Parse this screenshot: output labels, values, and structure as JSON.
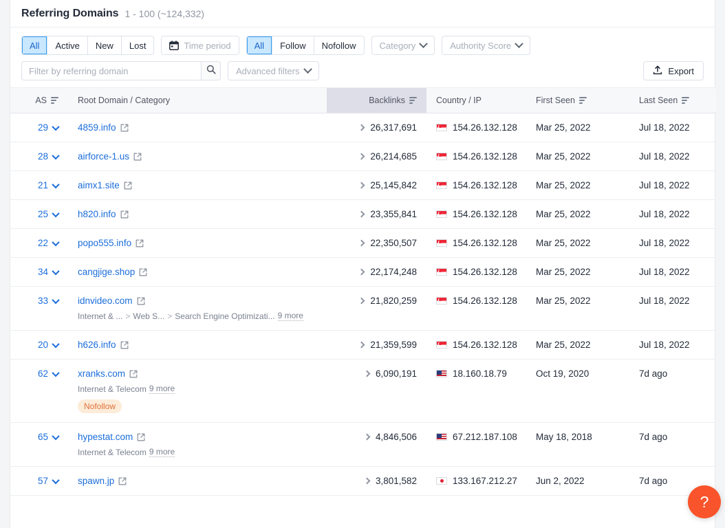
{
  "header": {
    "title": "Referring Domains",
    "range": "1 - 100 (~124,332)"
  },
  "filters": {
    "status_group": [
      "All",
      "Active",
      "New",
      "Lost"
    ],
    "status_active": "All",
    "time_period_label": "Time period",
    "follow_group": [
      "All",
      "Follow",
      "Nofollow"
    ],
    "follow_active": "All",
    "category_label": "Category",
    "authority_label": "Authority Score",
    "search_placeholder": "Filter by referring domain",
    "search_value": "",
    "advanced_filters_label": "Advanced filters",
    "export_label": "Export"
  },
  "table": {
    "columns": [
      {
        "key": "as",
        "label": "AS",
        "sortable": true,
        "highlight": false
      },
      {
        "key": "domain",
        "label": "Root Domain / Category",
        "sortable": false,
        "highlight": false
      },
      {
        "key": "backlinks",
        "label": "Backlinks",
        "sortable": true,
        "highlight": true
      },
      {
        "key": "country",
        "label": "Country / IP",
        "sortable": false,
        "highlight": false
      },
      {
        "key": "first_seen",
        "label": "First Seen",
        "sortable": true,
        "highlight": false
      },
      {
        "key": "last_seen",
        "label": "Last Seen",
        "sortable": true,
        "highlight": false
      }
    ],
    "rows": [
      {
        "as": "29",
        "domain": "4859.info",
        "categories": [],
        "more": null,
        "badge": null,
        "backlinks": "26,317,691",
        "flag": "sg",
        "ip": "154.26.132.128",
        "first_seen": "Mar 25, 2022",
        "last_seen": "Jul 18, 2022"
      },
      {
        "as": "28",
        "domain": "airforce-1.us",
        "categories": [],
        "more": null,
        "badge": null,
        "backlinks": "26,214,685",
        "flag": "sg",
        "ip": "154.26.132.128",
        "first_seen": "Mar 25, 2022",
        "last_seen": "Jul 18, 2022"
      },
      {
        "as": "21",
        "domain": "aimx1.site",
        "categories": [],
        "more": null,
        "badge": null,
        "backlinks": "25,145,842",
        "flag": "sg",
        "ip": "154.26.132.128",
        "first_seen": "Mar 25, 2022",
        "last_seen": "Jul 18, 2022"
      },
      {
        "as": "25",
        "domain": "h820.info",
        "categories": [],
        "more": null,
        "badge": null,
        "backlinks": "23,355,841",
        "flag": "sg",
        "ip": "154.26.132.128",
        "first_seen": "Mar 25, 2022",
        "last_seen": "Jul 18, 2022"
      },
      {
        "as": "22",
        "domain": "popo555.info",
        "categories": [],
        "more": null,
        "badge": null,
        "backlinks": "22,350,507",
        "flag": "sg",
        "ip": "154.26.132.128",
        "first_seen": "Mar 25, 2022",
        "last_seen": "Jul 18, 2022"
      },
      {
        "as": "34",
        "domain": "cangjige.shop",
        "categories": [],
        "more": null,
        "badge": null,
        "backlinks": "22,174,248",
        "flag": "sg",
        "ip": "154.26.132.128",
        "first_seen": "Mar 25, 2022",
        "last_seen": "Jul 18, 2022"
      },
      {
        "as": "33",
        "domain": "idnvideo.com",
        "categories": [
          "Internet & ...",
          "Web S...",
          "Search Engine Optimizati..."
        ],
        "more": "9 more",
        "badge": null,
        "backlinks": "21,820,259",
        "flag": "sg",
        "ip": "154.26.132.128",
        "first_seen": "Mar 25, 2022",
        "last_seen": "Jul 18, 2022"
      },
      {
        "as": "20",
        "domain": "h626.info",
        "categories": [],
        "more": null,
        "badge": null,
        "backlinks": "21,359,599",
        "flag": "sg",
        "ip": "154.26.132.128",
        "first_seen": "Mar 25, 2022",
        "last_seen": "Jul 18, 2022"
      },
      {
        "as": "62",
        "domain": "xranks.com",
        "categories": [
          "Internet & Telecom"
        ],
        "more": "9 more",
        "badge": "Nofollow",
        "backlinks": "6,090,191",
        "flag": "us",
        "ip": "18.160.18.79",
        "first_seen": "Oct 19, 2020",
        "last_seen": "7d ago"
      },
      {
        "as": "65",
        "domain": "hypestat.com",
        "categories": [
          "Internet & Telecom"
        ],
        "more": "9 more",
        "badge": null,
        "backlinks": "4,846,506",
        "flag": "us",
        "ip": "67.212.187.108",
        "first_seen": "May 18, 2018",
        "last_seen": "7d ago"
      },
      {
        "as": "57",
        "domain": "spawn.jp",
        "categories": [],
        "more": null,
        "badge": null,
        "backlinks": "3,801,582",
        "flag": "jp",
        "ip": "133.167.212.27",
        "first_seen": "Jun 2, 2022",
        "last_seen": "7d ago"
      }
    ]
  },
  "help": {
    "label": "?"
  },
  "colors": {
    "accent_blue": "#1b6ddb",
    "active_pill_bg": "#c9e7ff",
    "badge_bg": "#fdecd9",
    "badge_text": "#e2703a",
    "help_fab": "#f9542b",
    "header_highlight": "#dedee8"
  }
}
